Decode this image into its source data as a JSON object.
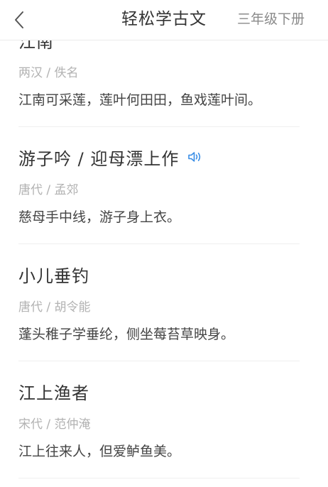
{
  "nav": {
    "title": "轻松学古文",
    "grade_link": "三年级下册"
  },
  "poems": [
    {
      "title": "江南",
      "author": "两汉 / 佚名",
      "line": "江南可采莲，莲叶何田田，鱼戏莲叶间。",
      "has_audio": false
    },
    {
      "title": "游子吟 / 迎母漂上作",
      "author": "唐代 / 孟郊",
      "line": "慈母手中线，游子身上衣。",
      "has_audio": true
    },
    {
      "title": "小儿垂钓",
      "author": "唐代 / 胡令能",
      "line": "蓬头稚子学垂纶，侧坐莓苔草映身。",
      "has_audio": false
    },
    {
      "title": "江上渔者",
      "author": "宋代 / 范仲淹",
      "line": "江上往来人，但爱鲈鱼美。",
      "has_audio": false
    }
  ],
  "icons": {
    "back": "chevron-left-icon",
    "audio": "speaker-icon"
  },
  "colors": {
    "title_text": "#333333",
    "meta_text": "#b2b2b2",
    "audio_accent": "#3a8ee6",
    "divider": "#efefef"
  }
}
